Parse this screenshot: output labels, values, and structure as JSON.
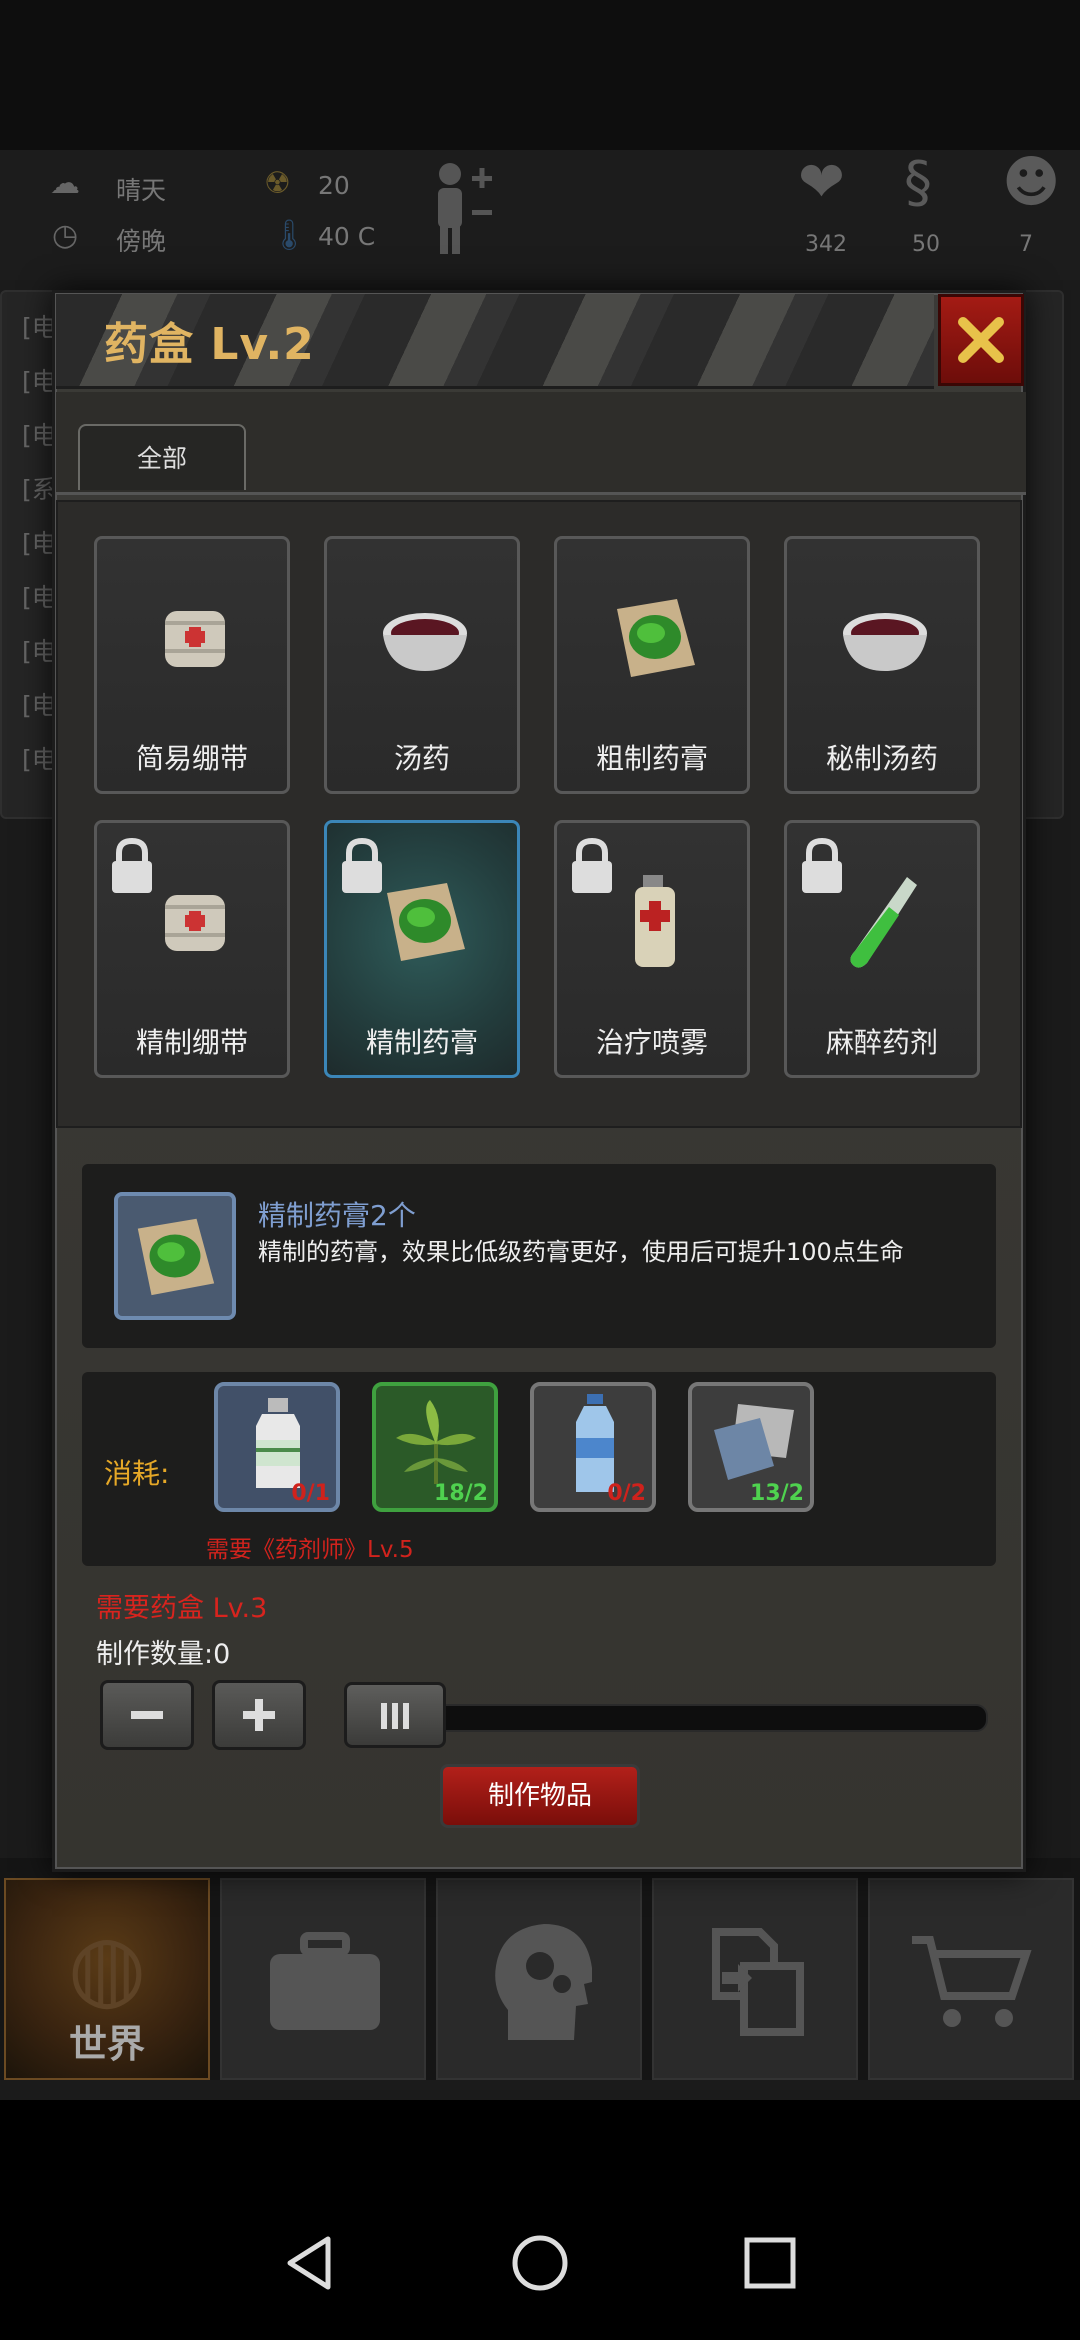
{
  "status": {
    "weather": "晴天",
    "time_of_day": "傍晚",
    "radiation": "20",
    "temperature": "40 C",
    "health": "342",
    "hunger": "50",
    "mind": "7"
  },
  "log_lines": [
    "[电",
    "[电",
    "[电",
    "[系",
    "[电",
    "[电",
    "[电",
    "[电",
    "[电"
  ],
  "dialog": {
    "title": "药盒 Lv.2",
    "filter_tab": "全部",
    "items": [
      {
        "label": "简易绷带",
        "icon": "bandage-icon",
        "locked": false
      },
      {
        "label": "汤药",
        "icon": "soup-bowl-icon",
        "locked": false
      },
      {
        "label": "粗制药膏",
        "icon": "ointment-icon",
        "locked": false
      },
      {
        "label": "秘制汤药",
        "icon": "soup-bowl-icon",
        "locked": false
      },
      {
        "label": "精制绷带",
        "icon": "bandage-icon",
        "locked": true
      },
      {
        "label": "精制药膏",
        "icon": "ointment-icon",
        "locked": true,
        "selected": true
      },
      {
        "label": "治疗喷雾",
        "icon": "spray-can-icon",
        "locked": true
      },
      {
        "label": "麻醉药剂",
        "icon": "test-tube-icon",
        "locked": true
      }
    ],
    "detail": {
      "name": "精制药膏2个",
      "description": "精制的药膏，效果比低级药膏更好，使用后可提升100点生命"
    },
    "consume": {
      "label": "消耗:",
      "materials": [
        {
          "icon": "medicine-bottle-icon",
          "count": "0/1",
          "count_color": "#d0221c"
        },
        {
          "icon": "herb-leaf-icon",
          "count": "18/2",
          "count_color": "#4fd24f"
        },
        {
          "icon": "water-bottle-icon",
          "count": "0/2",
          "count_color": "#d0221c"
        },
        {
          "icon": "cloth-icon",
          "count": "13/2",
          "count_color": "#4fd24f"
        }
      ],
      "requirement": "需要《药剂师》Lv.5"
    },
    "need_box": "需要药盒 Lv.3",
    "craft_count": "制作数量:0",
    "make_button": "制作物品"
  },
  "tabs": [
    {
      "label": "世界",
      "icon": "globe-icon",
      "active": true
    },
    {
      "label": "",
      "icon": "briefcase-icon",
      "active": false
    },
    {
      "label": "",
      "icon": "head-gears-icon",
      "active": false
    },
    {
      "label": "",
      "icon": "transfer-icon",
      "active": false
    },
    {
      "label": "",
      "icon": "cart-icon",
      "active": false
    }
  ],
  "colors": {
    "title": "#e0b462",
    "close": "#a41b14",
    "selected_border": "#3b86b8",
    "warning": "#d8241e",
    "consume_label": "#e6a827"
  }
}
